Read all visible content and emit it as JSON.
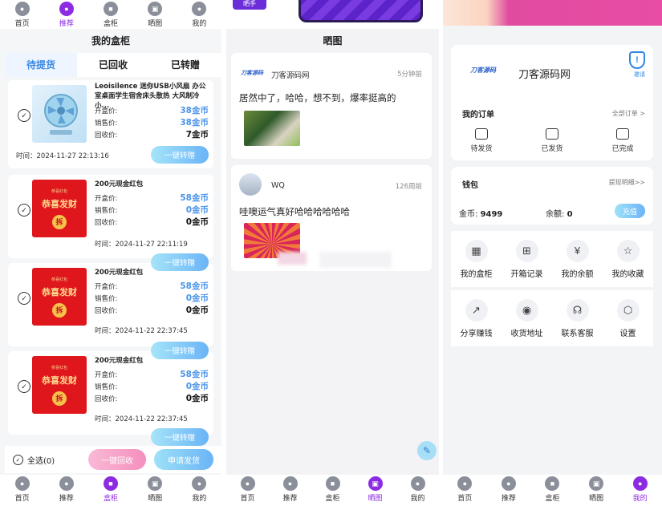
{
  "top_nav": [
    {
      "label": "首页",
      "icon": "home-icon",
      "active": false
    },
    {
      "label": "推荐",
      "icon": "recommend-icon",
      "active": true
    },
    {
      "label": "盒柜",
      "icon": "cabinet-icon",
      "active": false
    },
    {
      "label": "晒图",
      "icon": "photo-icon",
      "active": false
    },
    {
      "label": "我的",
      "icon": "user-icon",
      "active": false
    }
  ],
  "cabinet": {
    "title": "我的盒柜",
    "tabs": [
      "待提货",
      "已回收",
      "已转赠"
    ],
    "labels": {
      "open": "开盒价:",
      "sale": "销售价:",
      "recycle": "回收价:"
    },
    "items": [
      {
        "name": "Leoisilence 迷你USB小风扇 办公室桌面学生宿舍床头散热 大风制冷小...",
        "open": "38金币",
        "sale": "38金币",
        "recycle": "7金币",
        "time": "时间：2024-11-27 22:13:16",
        "button": "一键转赠"
      },
      {
        "name": "200元现金红包",
        "open": "58金币",
        "sale": "0金币",
        "recycle": "0金币",
        "time": "时间：2024-11-27 22:11:19",
        "button": "一键转赠"
      },
      {
        "name": "200元现金红包",
        "open": "58金币",
        "sale": "0金币",
        "recycle": "0金币",
        "time": "时间：2024-11-22 22:37:45",
        "button": "一键转赠"
      },
      {
        "name": "200元现金红包",
        "open": "58金币",
        "sale": "0金币",
        "recycle": "0金币",
        "time": "时间：2024-11-22 22:37:45",
        "button": "一键转赠"
      }
    ],
    "redpacket": {
      "top": "恭喜红包",
      "main": "恭喜发财",
      "coin": "拆"
    },
    "select_all": "全选(0)",
    "recycle_button": "一键回收",
    "ship_button": "申请发货"
  },
  "nav_cabinet": [
    {
      "label": "首页",
      "icon": "home-icon"
    },
    {
      "label": "推荐",
      "icon": "recommend-icon"
    },
    {
      "label": "盒柜",
      "icon": "cabinet-icon",
      "active": true
    },
    {
      "label": "晒图",
      "icon": "photo-icon"
    },
    {
      "label": "我的",
      "icon": "user-icon"
    }
  ],
  "feed": {
    "title": "晒图",
    "banner_tag": "晒手",
    "posts": [
      {
        "user": "刀客源码网",
        "logo": "刀客源码",
        "time": "5分钟前",
        "text": "居然中了，哈哈，想不到，爆率挺高的"
      },
      {
        "user": "WQ",
        "time": "126周前",
        "text": "哇噢运气真好哈哈哈哈哈哈"
      }
    ]
  },
  "nav_feed": [
    {
      "label": "首页",
      "icon": "home-icon"
    },
    {
      "label": "推荐",
      "icon": "recommend-icon"
    },
    {
      "label": "盒柜",
      "icon": "cabinet-icon"
    },
    {
      "label": "晒图",
      "icon": "photo-icon",
      "active": true
    },
    {
      "label": "我的",
      "icon": "user-icon"
    }
  ],
  "profile": {
    "brand_logo": "刀客源码",
    "brand_name": "刀客源码网",
    "shield_label": "邀请",
    "orders_title": "我的订单",
    "orders_link": "全部订单 >",
    "orders": [
      {
        "label": "待发货",
        "icon": "pending-ship-icon"
      },
      {
        "label": "已发货",
        "icon": "truck-icon"
      },
      {
        "label": "已完成",
        "icon": "done-box-icon"
      }
    ],
    "wallet_title": "钱包",
    "wallet_link": "提现明细>>",
    "coin_label": "金币:",
    "coin_value": "9499",
    "balance_label": "余额:",
    "balance_value": "0",
    "recharge": "充值",
    "grid": [
      {
        "label": "我的盒柜",
        "icon": "cabinet-icon",
        "glyph": "▦"
      },
      {
        "label": "开箱记录",
        "icon": "gift-box-icon",
        "glyph": "⊞"
      },
      {
        "label": "我的余额",
        "icon": "wallet-icon",
        "glyph": "¥"
      },
      {
        "label": "我的收藏",
        "icon": "star-icon",
        "glyph": "☆"
      },
      {
        "label": "分享赚钱",
        "icon": "share-icon",
        "glyph": "↗"
      },
      {
        "label": "收货地址",
        "icon": "location-icon",
        "glyph": "◉"
      },
      {
        "label": "联系客服",
        "icon": "headset-icon",
        "glyph": "☊"
      },
      {
        "label": "设置",
        "icon": "settings-icon",
        "glyph": "⬡"
      }
    ]
  },
  "nav_profile": [
    {
      "label": "首页",
      "icon": "home-icon"
    },
    {
      "label": "推荐",
      "icon": "recommend-icon"
    },
    {
      "label": "盒柜",
      "icon": "cabinet-icon"
    },
    {
      "label": "晒图",
      "icon": "photo-icon"
    },
    {
      "label": "我的",
      "icon": "user-icon",
      "active": true
    }
  ],
  "colors": {
    "accent": "#8c2be2",
    "blue": "#4b94e8",
    "pink": "#f59cc6"
  }
}
